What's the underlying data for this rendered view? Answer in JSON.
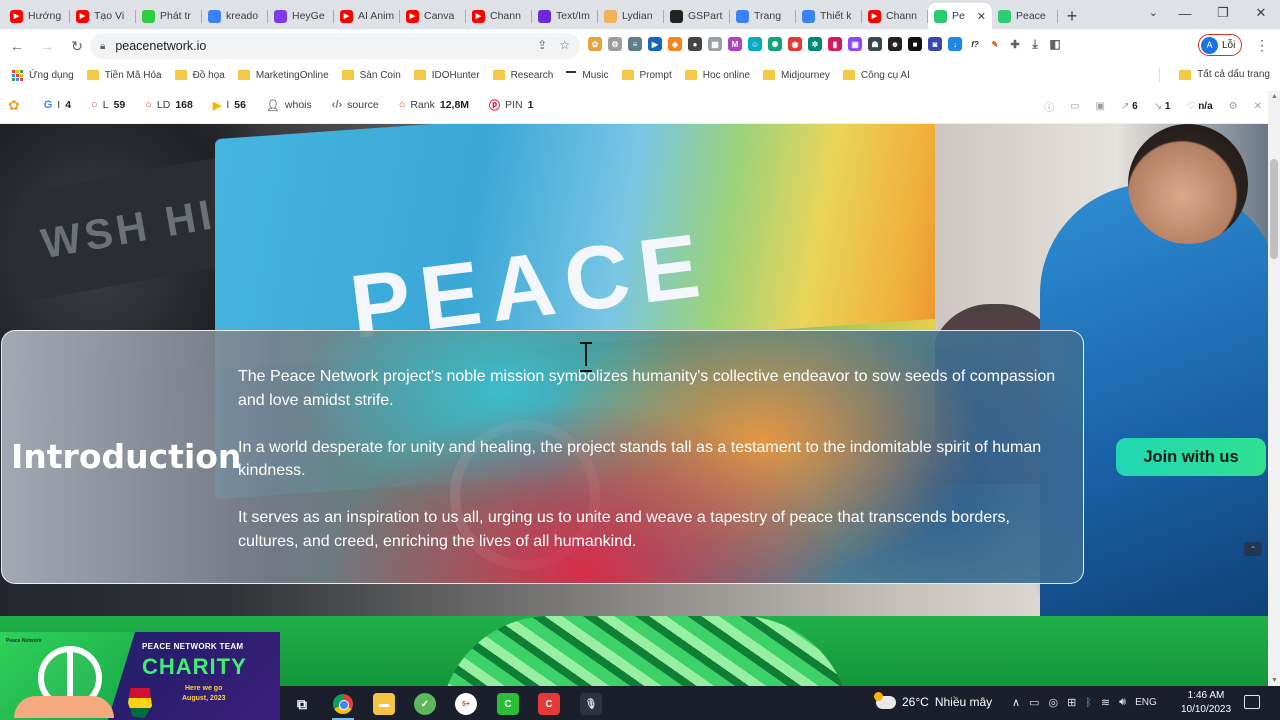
{
  "tabs": [
    {
      "label": "Hướng",
      "icon": "youtube-icon",
      "color": "#ff0000"
    },
    {
      "label": "Tạo Vi",
      "icon": "youtube-icon",
      "color": "#ff0000"
    },
    {
      "label": "Phát tr",
      "icon": "green-circle-icon",
      "color": "#2ecc40"
    },
    {
      "label": "kreado",
      "icon": "kreado-icon",
      "color": "#3b82f6"
    },
    {
      "label": "HeyGe",
      "icon": "heygen-icon",
      "color": "#7c3aed"
    },
    {
      "label": "AI Anim",
      "icon": "youtube-icon",
      "color": "#ff0000"
    },
    {
      "label": "Canva",
      "icon": "youtube-icon",
      "color": "#ff0000"
    },
    {
      "label": "Chann",
      "icon": "youtube-icon",
      "color": "#ff0000"
    },
    {
      "label": "Text/Im",
      "icon": "r-logo-icon",
      "color": "#6d28d9"
    },
    {
      "label": "Lydian",
      "icon": "lydian-icon",
      "color": "#f0b35a"
    },
    {
      "label": "GSPart",
      "icon": "gspartners-icon",
      "color": "#222222"
    },
    {
      "label": "Trang",
      "icon": "c-logo-icon",
      "color": "#3b82f6"
    },
    {
      "label": "Thiết k",
      "icon": "c-logo-icon",
      "color": "#3b82f6"
    },
    {
      "label": "Chann",
      "icon": "youtube-icon",
      "color": "#ff0000"
    },
    {
      "label": "Pe",
      "icon": "peace-icon",
      "color": "#2ecc71",
      "active": true
    },
    {
      "label": "Peace",
      "icon": "peace-icon",
      "color": "#2ecc71"
    }
  ],
  "toolbar": {
    "url": "peacenetwork.io",
    "profile_initial": "A",
    "profile_label": "Lỗi"
  },
  "bookmarks": {
    "apps_label": "Ứng dụng",
    "items": [
      "Tiền Mã Hóa",
      "Đồ họa",
      "MarketingOnline",
      "Sàn Coin",
      "IDOHunter",
      "Research",
      "Music",
      "Prompt",
      "Hoc online",
      "Midjourney",
      "Công cụ AI"
    ],
    "all_label": "Tất cả dấu trang"
  },
  "seo": {
    "google_index": "4",
    "l_value": "59",
    "ld_value": "168",
    "bing_value": "56",
    "whois_label": "whois",
    "source_label": "source",
    "rank_label": "Rank",
    "rank_value": "12,8M",
    "pin_label": "PIN",
    "pin_value": "1",
    "ext_links": "6",
    "int_links": "1",
    "na_label": "n/a"
  },
  "hero": {
    "flag_text": "PEACE",
    "sign_text": "WSH HILL"
  },
  "intro": {
    "title": "Introduction",
    "paragraphs": [
      "The Peace Network project's noble mission symbolizes humanity's collective endeavor to sow seeds of compassion and love amidst strife.",
      "In a world desperate for unity and healing, the project stands tall as a testament to the indomitable spirit of human kindness.",
      "It serves as an inspiration to us all, urging us to unite and weave a tapestry of peace that transcends borders, cultures, and creed, enriching the lives of all humankind."
    ],
    "join_label": "Join with us"
  },
  "promo": {
    "logo_text": "Peace Network",
    "team_line": "PEACE NETWORK TEAM",
    "headline": "CHARITY",
    "line1": "Here we go",
    "line2": "August, 2023"
  },
  "taskbar": {
    "weather_temp": "26°C",
    "weather_desc": "Nhiều mây",
    "lang": "ENG",
    "time": "1:46 AM",
    "date": "10/10/2023",
    "badge": "5+"
  },
  "colors": {
    "accent_green": "#2ee08f",
    "taskbar_bg": "#1a1f2b",
    "tabstrip_bg": "#dee1e6"
  }
}
